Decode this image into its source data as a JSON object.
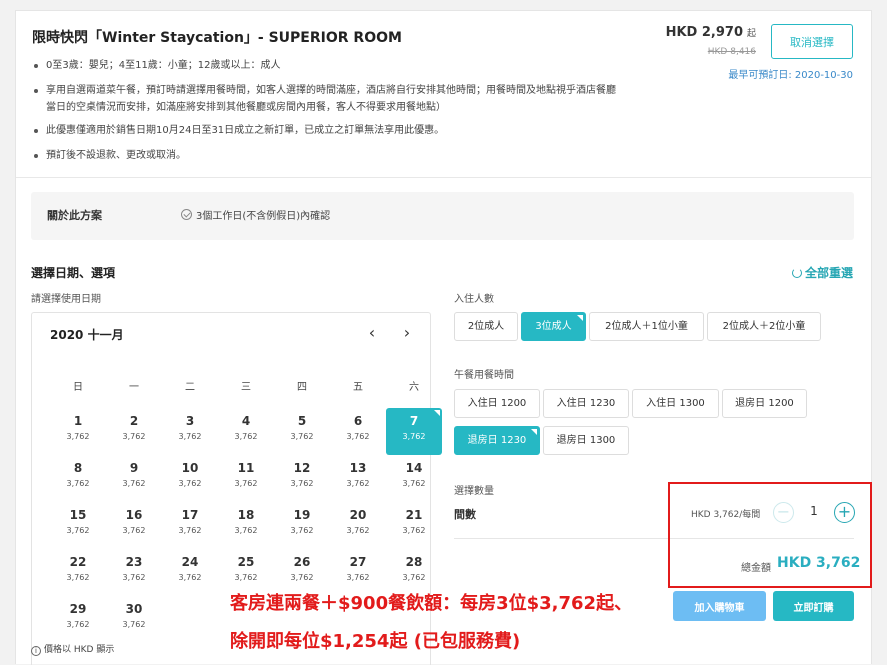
{
  "offer": {
    "title": "限時快閃「Winter Staycation」- SUPERIOR ROOM",
    "bullets": [
      [
        "0至3歲：嬰兒；4至11歲：小童；12歲或以上：成人"
      ],
      [
        "享用自選兩道菜午餐，預訂時請選擇用餐時間，如客人選擇的時間滿座，酒店將自行安排其他時間；用餐時間及地點視乎酒店餐廳",
        "當日的空桌情況而安排，如滿座將安排到其他餐廳或房間內用餐，客人不得要求用餐地點）"
      ],
      [
        "此優惠僅適用於銷售日期10月24日至31日成立之新訂單，已成立之訂單無法享用此優惠。"
      ],
      [
        "預訂後不設退款、更改或取消。"
      ]
    ],
    "price": "HKD 2,970",
    "price_suffix": "起",
    "old_price": "HKD 8,416",
    "cancel_label": "取消選擇",
    "earliest": "最早可預訂日: 2020-10-30"
  },
  "about": {
    "label": "關於此方案",
    "value": "3個工作日(不含例假日)內確認"
  },
  "section_title": "選擇日期、選項",
  "reset_label": "全部重選",
  "date_label": "請選擇使用日期",
  "calendar": {
    "month": "2020 十一月",
    "prev": "‹",
    "next": "›",
    "weekdays": [
      "日",
      "一",
      "二",
      "三",
      "四",
      "五",
      "六"
    ],
    "days": [
      {
        "d": "1",
        "p": "3,762"
      },
      {
        "d": "2",
        "p": "3,762"
      },
      {
        "d": "3",
        "p": "3,762"
      },
      {
        "d": "4",
        "p": "3,762"
      },
      {
        "d": "5",
        "p": "3,762"
      },
      {
        "d": "6",
        "p": "3,762"
      },
      {
        "d": "7",
        "p": "3,762",
        "sel": true
      },
      {
        "d": "8",
        "p": "3,762"
      },
      {
        "d": "9",
        "p": "3,762"
      },
      {
        "d": "10",
        "p": "3,762"
      },
      {
        "d": "11",
        "p": "3,762"
      },
      {
        "d": "12",
        "p": "3,762"
      },
      {
        "d": "13",
        "p": "3,762"
      },
      {
        "d": "14",
        "p": "3,762"
      },
      {
        "d": "15",
        "p": "3,762"
      },
      {
        "d": "16",
        "p": "3,762"
      },
      {
        "d": "17",
        "p": "3,762"
      },
      {
        "d": "18",
        "p": "3,762"
      },
      {
        "d": "19",
        "p": "3,762"
      },
      {
        "d": "20",
        "p": "3,762"
      },
      {
        "d": "21",
        "p": "3,762"
      },
      {
        "d": "22",
        "p": "3,762"
      },
      {
        "d": "23",
        "p": "3,762"
      },
      {
        "d": "24",
        "p": "3,762"
      },
      {
        "d": "25",
        "p": "3,762"
      },
      {
        "d": "26",
        "p": "3,762"
      },
      {
        "d": "27",
        "p": "3,762"
      },
      {
        "d": "28",
        "p": "3,762"
      },
      {
        "d": "29",
        "p": "3,762"
      },
      {
        "d": "30",
        "p": "3,762"
      }
    ]
  },
  "guests": {
    "label": "入住人數",
    "options": [
      {
        "label": "2位成人"
      },
      {
        "label": "3位成人",
        "sel": true
      },
      {
        "label": "2位成人＋1位小童"
      },
      {
        "label": "2位成人＋2位小童"
      }
    ]
  },
  "lunch": {
    "label": "午餐用餐時間",
    "options": [
      {
        "label": "入住日 1200"
      },
      {
        "label": "入住日 1230"
      },
      {
        "label": "入住日 1300"
      },
      {
        "label": "退房日 1200"
      },
      {
        "label": "退房日 1230",
        "sel": true
      },
      {
        "label": "退房日 1300"
      }
    ]
  },
  "quantity": {
    "label": "選擇數量",
    "item": "間數",
    "unit_price": "HKD 3,762/每間",
    "minus": "−",
    "value": "1",
    "plus": "+",
    "total_label": "總金額",
    "total": "HKD 3,762"
  },
  "buttons": {
    "cart": "加入購物車",
    "book": "立即訂購"
  },
  "promo": [
    "客房連兩餐＋$900餐飲額：每房3位$3,762起、",
    "除開即每位$1,254起 (已包服務費)"
  ],
  "note": {
    "icon": "i",
    "text": "價格以 HKD 顯示"
  },
  "colors": {
    "accent": "#26b8c4",
    "highlight": "#e21b1b",
    "cart": "#6dbdf3"
  }
}
